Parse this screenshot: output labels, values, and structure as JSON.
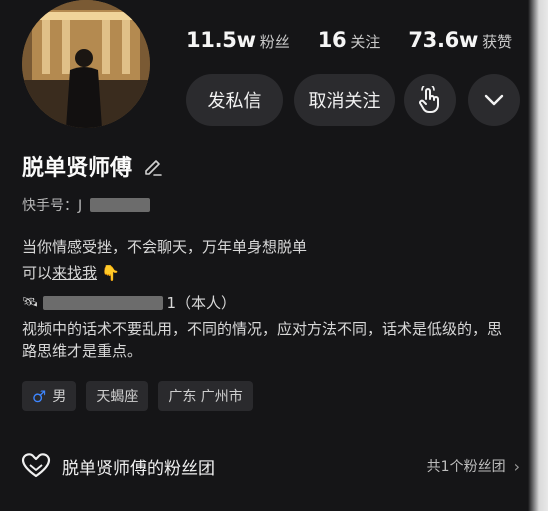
{
  "stats": [
    {
      "value": "11.5w",
      "label": "粉丝"
    },
    {
      "value": "16",
      "label": "关注"
    },
    {
      "value": "73.6w",
      "label": "获赞"
    }
  ],
  "actions": {
    "message_label": "发私信",
    "unfollow_label": "取消关注",
    "poke_icon": "hand-tap-icon",
    "more_icon": "chevron-down-icon"
  },
  "profile": {
    "name": "脱单贤师傅",
    "kuaishou_id_label": "快手号：J",
    "bio_line1": "当你情感受挫，不会聊天，万年单身想脱单",
    "bio_line2_prefix": "可以",
    "bio_line2_link": "来找我",
    "bio_line2_emoji": "👇",
    "bio_line3_suffix": "1（本人）",
    "bio_line4": "视频中的话术不要乱用，不同的情况，应对方法不同，话术是低级的，思路思维才是重点。"
  },
  "tags": {
    "gender_symbol": "♂",
    "gender": "男",
    "zodiac": "天蝎座",
    "location": "广东 广州市"
  },
  "fan_club": {
    "title": "脱单贤师傅的粉丝团",
    "count": "共1个粉丝团"
  }
}
